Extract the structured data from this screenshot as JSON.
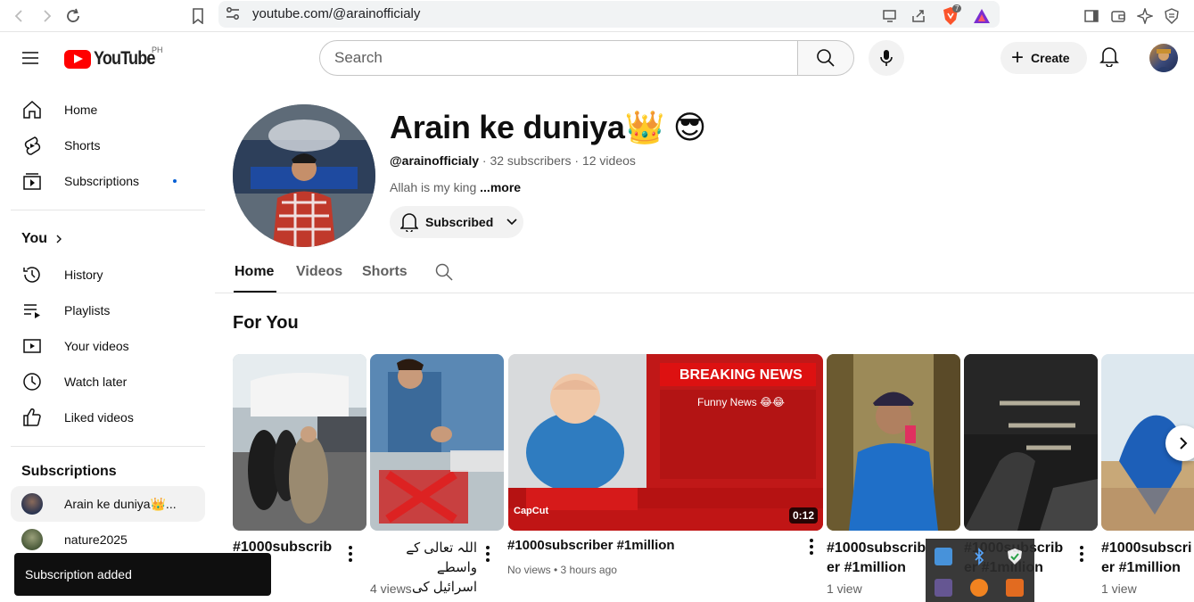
{
  "browser": {
    "url": "youtube.com/@arainofficialy",
    "extension_badge": "7"
  },
  "header": {
    "logo_text": "YouTube",
    "country_code": "PH",
    "search_placeholder": "Search",
    "create_label": "Create"
  },
  "sidebar": {
    "main": [
      {
        "label": "Home",
        "icon": "home-icon"
      },
      {
        "label": "Shorts",
        "icon": "shorts-icon"
      },
      {
        "label": "Subscriptions",
        "icon": "subscriptions-icon"
      }
    ],
    "you_label": "You",
    "you_items": [
      {
        "label": "History",
        "icon": "history-icon"
      },
      {
        "label": "Playlists",
        "icon": "playlists-icon"
      },
      {
        "label": "Your videos",
        "icon": "your-videos-icon"
      },
      {
        "label": "Watch later",
        "icon": "watch-later-icon"
      },
      {
        "label": "Liked videos",
        "icon": "liked-videos-icon"
      }
    ],
    "subscriptions_title": "Subscriptions",
    "subscriptions": [
      {
        "label": "Arain ke duniya👑..."
      },
      {
        "label": "nature2025"
      }
    ]
  },
  "channel": {
    "name": "Arain ke duniya👑 😎",
    "handle": "@arainofficialy",
    "stats": " · 32 subscribers · 12 videos",
    "description": "Allah is my king ",
    "more": "...more",
    "subscribed_label": "Subscribed"
  },
  "tabs": [
    "Home",
    "Videos",
    "Shorts"
  ],
  "section_title": "For You",
  "videos": [
    {
      "title": "#1000subscrib",
      "meta": ""
    },
    {
      "title_line1": "اللہ تعالی کے واسطے",
      "title_line2": "اسرائیل کی چیزوں...",
      "meta": "4 views"
    },
    {
      "title": "#1000subscriber #1million",
      "meta": "No views • 3 hours ago",
      "duration": "0:12",
      "overlay_headline": "BREAKING NEWS",
      "overlay_sub": "Funny News 😂😂",
      "overlay_brand": "CapCut"
    },
    {
      "title_line1": "#1000subscrib",
      "title_line2": "er #1million",
      "meta": "1 view"
    },
    {
      "title_line1": "#1000subscrib",
      "title_line2": "er #1million",
      "meta": ""
    },
    {
      "title_line1": "#1000subscri",
      "title_line2": "er #1million",
      "meta": "1 view"
    }
  ],
  "toast": "Subscription added",
  "colors": {
    "brand_red": "#ff0000",
    "text_primary": "#0f0f0f",
    "text_secondary": "#606060",
    "chip_bg": "#f2f2f2",
    "notification_dot": "#065fd4"
  }
}
